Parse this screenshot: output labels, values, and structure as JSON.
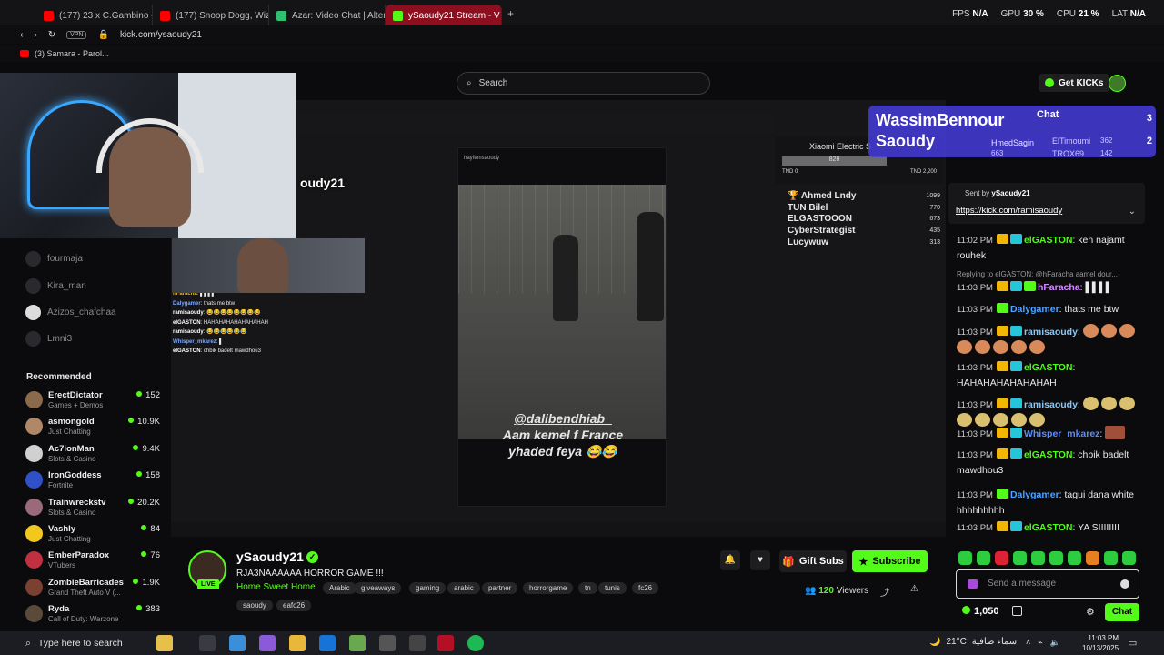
{
  "browser": {
    "tabs": [
      {
        "label": "(177) 23 x C.Gambino - D",
        "icon_color": "#ff0000"
      },
      {
        "label": "(177) Snoop Dogg, Wiz K",
        "icon_color": "#ff0000"
      },
      {
        "label": "Azar: Video Chat | Altern",
        "icon_color": "#2fbf71"
      },
      {
        "label": "ySaoudy21 Stream - V",
        "icon_color": "#53fc18",
        "active": true
      }
    ],
    "perf": {
      "fps_label": "FPS",
      "fps": "N/A",
      "gpu_label": "GPU",
      "gpu": "30 %",
      "cpu_label": "CPU",
      "cpu": "21 %",
      "lat_label": "LAT",
      "lat": "N/A"
    },
    "vpn_label": "VPN",
    "url": "kick.com/ysaoudy21",
    "bookmark": "(3) Samara - Parol..."
  },
  "header": {
    "search_placeholder": "Search",
    "get_kicks": "Get KICKs"
  },
  "sidebar": {
    "following": [
      "fourmaja",
      "Kira_man",
      "Azizos_chafchaa",
      "Lmni3"
    ],
    "recommended_title": "Recommended",
    "recommended": [
      {
        "name": "ErectDictator",
        "category": "Games + Demos",
        "viewers": "152",
        "color": "#8a6a4a"
      },
      {
        "name": "asmongold",
        "category": "Just Chatting",
        "viewers": "10.9K",
        "color": "#b08868"
      },
      {
        "name": "Ac7ionMan",
        "category": "Slots & Casino",
        "viewers": "9.4K",
        "color": "#d0d0d0"
      },
      {
        "name": "IronGoddess",
        "category": "Fortnite",
        "viewers": "158",
        "color": "#3050c8"
      },
      {
        "name": "Trainwreckstv",
        "category": "Slots & Casino",
        "viewers": "20.2K",
        "color": "#9a6a7a"
      },
      {
        "name": "Vashly",
        "category": "Just Chatting",
        "viewers": "84",
        "color": "#f2c81e"
      },
      {
        "name": "EmberParadox",
        "category": "VTubers",
        "viewers": "76",
        "color": "#c03040"
      },
      {
        "name": "ZombieBarricades",
        "category": "Grand Theft Auto V (...",
        "viewers": "1.9K",
        "color": "#7a4030"
      },
      {
        "name": "Ryda",
        "category": "Call of Duty: Warzone",
        "viewers": "383",
        "color": "#5a4a3a"
      }
    ]
  },
  "video": {
    "streamer_overlay": "oudy21",
    "inner_chat": [
      {
        "name": "hFaracha",
        "text": ": ▌▌▌▌",
        "color": "#f2b705"
      },
      {
        "name": "Dalygamer",
        "text": ": thats me btw",
        "color": "#7aa7ff"
      },
      {
        "name": "ramisaoudy",
        "text": ": 😂😂😂😂😂😂😂😂",
        "color": "#ffffff"
      },
      {
        "name": "elGASTON",
        "text": ": HAHAHAHAHAHAHAHAH",
        "color": "#ffffff"
      },
      {
        "name": "ramisaoudy",
        "text": ": 😂😂😂😂😂😂",
        "color": "#ffffff"
      },
      {
        "name": "Whisper_mkarez",
        "text": ": ▌",
        "color": "#7aa7ff"
      },
      {
        "name": "elGASTON",
        "text": ": chbik badelt mawdhou3",
        "color": "#ffffff"
      }
    ],
    "story_handle": "hayfemsaoudy",
    "caption_handle": "@dalibendhiab_",
    "caption_line1": "Aam kemel f France",
    "caption_line2": "yhaded feya 😂😂",
    "electric": {
      "title": "Xiaomi Electric S",
      "bar": "828",
      "left": "TND 0",
      "right": "TND 2,200"
    },
    "leaderboard": [
      {
        "name": "Ahmed Lndy",
        "score": "1099"
      },
      {
        "name": "TUN Bilel",
        "score": "770"
      },
      {
        "name": "ELGASTOOON",
        "score": "673"
      },
      {
        "name": "CyberStrategist",
        "score": "435"
      },
      {
        "name": "Lucywuw",
        "score": "313"
      }
    ]
  },
  "stream": {
    "live_label": "LIVE",
    "name": "ySaoudy21",
    "title": "RJA3NAAAAAA HORROR GAME !!!",
    "category": "Home Sweet Home",
    "tags": [
      "Arabic",
      "giveaways",
      "gaming",
      "arabic",
      "partner",
      "horrorgame",
      "tn",
      "tunis",
      "fc26",
      "saoudy",
      "eafc26"
    ],
    "gift_subs": "Gift Subs",
    "subscribe": "Subscribe",
    "viewers": "120",
    "viewers_label": "Viewers"
  },
  "chat": {
    "title": "Chat",
    "goal": {
      "line1": "WassimBennour",
      "line2": "Saoudy",
      "n1": "3",
      "n2": "2",
      "gifters": [
        {
          "name": "HmedSagin",
          "count": "663"
        },
        {
          "name": "ElTimoumi",
          "count": "362"
        },
        {
          "name": "TROX69",
          "count": "142"
        }
      ]
    },
    "pinned": {
      "sent_by": "Sent by",
      "sender": "ySaoudy21",
      "link": "https://kick.com/ramisaoudy"
    },
    "reply_preview": "Replying to elGASTON: @hFaracha aamel dour...",
    "messages": [
      {
        "time": "11:02 PM",
        "name": "elGASTON",
        "color": "#53fc18",
        "badges": [
          "crown",
          "sub"
        ],
        "text": ": ken najamt rouhek"
      },
      {
        "time": "11:03 PM",
        "name": "hFaracha",
        "color": "#d38cff",
        "badges": [
          "crown",
          "sub",
          "vip"
        ],
        "text": ": ▌▌▌▌"
      },
      {
        "time": "11:03 PM",
        "name": "Dalygamer",
        "color": "#4ea4ff",
        "badges": [
          "vip"
        ],
        "text": ": thats me btw"
      },
      {
        "time": "11:03 PM",
        "name": "ramisaoudy",
        "color": "#7ecbff",
        "badges": [
          "crown",
          "sub"
        ],
        "text": ":"
      },
      {
        "time": "11:03 PM",
        "name": "elGASTON",
        "color": "#53fc18",
        "badges": [
          "crown",
          "sub"
        ],
        "text": ": HAHAHAHAHAHAHAH"
      },
      {
        "time": "11:03 PM",
        "name": "ramisaoudy",
        "color": "#7ecbff",
        "badges": [
          "crown",
          "sub"
        ],
        "text": ":"
      },
      {
        "time": "11:03 PM",
        "name": "Whisper_mkarez",
        "color": "#5b8bff",
        "badges": [
          "crown",
          "sub"
        ],
        "text": ":"
      },
      {
        "time": "11:03 PM",
        "name": "elGASTON",
        "color": "#53fc18",
        "badges": [
          "crown",
          "sub"
        ],
        "text": ": chbik badelt mawdhou3"
      },
      {
        "time": "11:03 PM",
        "name": "Dalygamer",
        "color": "#4ea4ff",
        "badges": [
          "vip"
        ],
        "text": ": tagui dana white hhhhhhhhh"
      },
      {
        "time": "11:03 PM",
        "name": "elGASTON",
        "color": "#53fc18",
        "badges": [
          "crown",
          "sub"
        ],
        "text": ": YA SIIIIIIII"
      }
    ],
    "input_placeholder": "Send a message",
    "kicks_balance": "1,050",
    "send_label": "Chat"
  },
  "taskbar": {
    "search_placeholder": "Type here to search",
    "weather_temp": "21°C",
    "weather_text": "سماء صافية",
    "time": "11:03 PM",
    "date": "10/13/2025"
  }
}
